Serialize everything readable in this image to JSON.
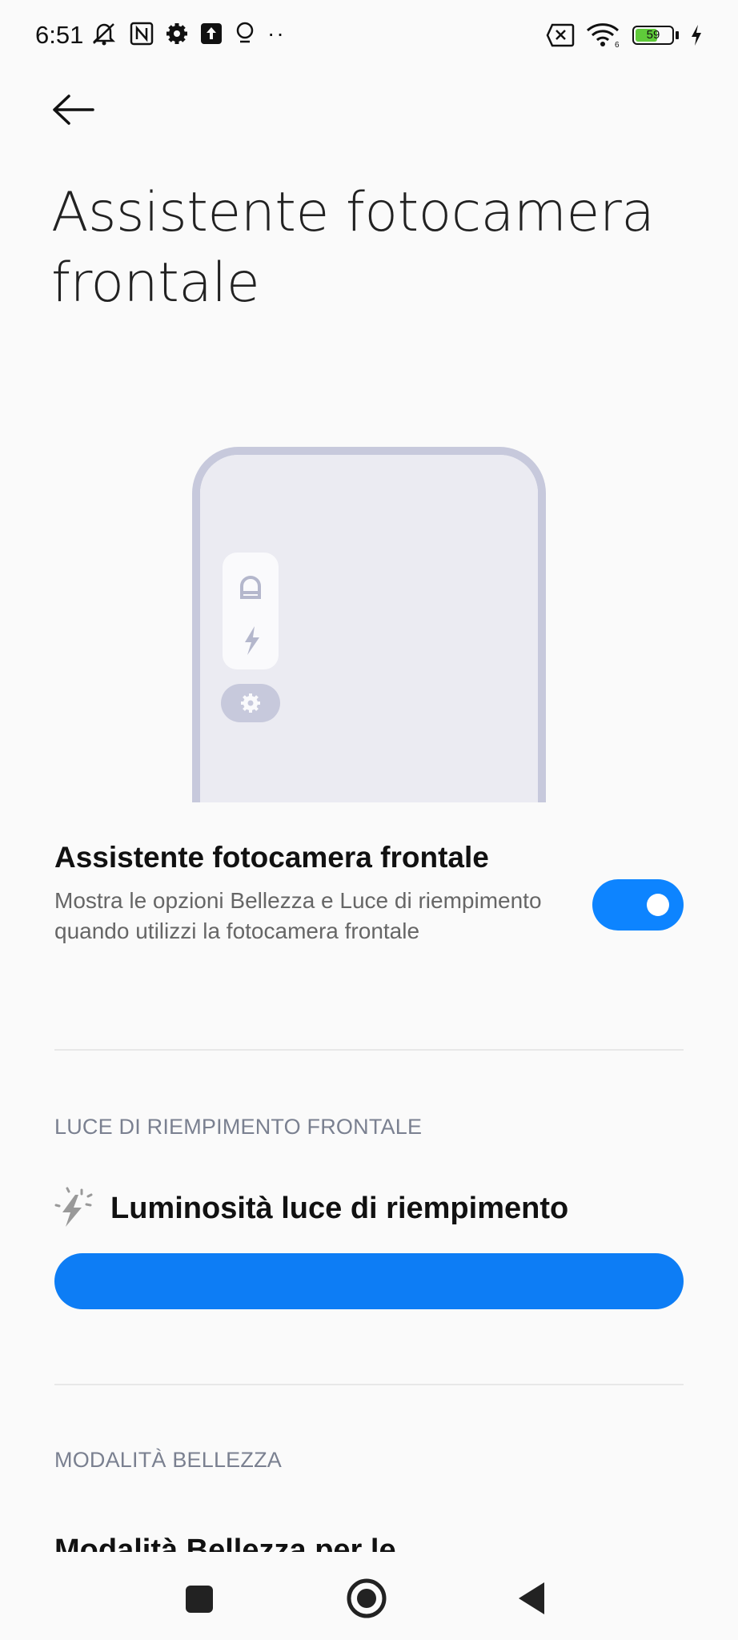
{
  "status_bar": {
    "time": "6:51",
    "battery": "59",
    "icons_left": [
      "mute-icon",
      "nfc-icon",
      "settings-icon",
      "upload-icon",
      "bulb-icon",
      "more-dots-icon"
    ],
    "icons_right": [
      "sim-off-icon",
      "wifi-icon",
      "battery-icon",
      "charging-icon"
    ]
  },
  "header": {
    "back_icon": "arrow-left-icon",
    "title": "Assistente fotocamera frontale"
  },
  "main_setting": {
    "title": "Assistente fotocamera frontale",
    "description": "Mostra le opzioni Bellezza e Luce di riempimento quando utilizzi la fotocamera frontale",
    "enabled": true
  },
  "fill_light_section": {
    "header": "LUCE DI RIEMPIMENTO FRONTALE",
    "brightness_label": "Luminosità luce di riempimento",
    "brightness_icon": "sparkle-bolt-icon",
    "brightness_level": 1.0
  },
  "beauty_section": {
    "header": "MODALITÀ BELLEZZA",
    "partial_item": "Modalità Bellezza per le"
  },
  "colors": {
    "accent": "#0d84ff",
    "illustration_frame": "#c7c9dc",
    "illustration_bg": "#ebebf2"
  },
  "nav_bar": [
    "recents-square-icon",
    "home-circle-icon",
    "back-triangle-icon"
  ]
}
